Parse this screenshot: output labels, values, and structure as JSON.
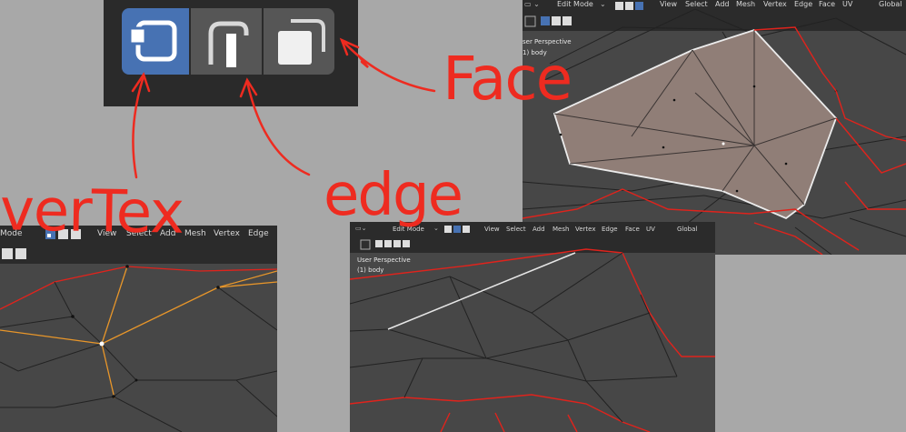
{
  "toolbar_zoom": {
    "buttons": [
      {
        "name": "vertex",
        "selected": true,
        "icon": "vertex-select-icon"
      },
      {
        "name": "edge",
        "selected": false,
        "icon": "edge-select-icon"
      },
      {
        "name": "face",
        "selected": false,
        "icon": "face-select-icon"
      }
    ],
    "colors": {
      "panel": "#2a2a2a",
      "button": "#565656",
      "selected": "#4772b3"
    }
  },
  "annotations": {
    "vertex": "verTex",
    "edge": "edge",
    "face": "Face",
    "color": "#ee2b20"
  },
  "face_panel": {
    "header": {
      "mode": "Edit Mode",
      "menu": [
        "View",
        "Select",
        "Add",
        "Mesh",
        "Vertex",
        "Edge",
        "Face",
        "UV"
      ],
      "transform": "Global"
    },
    "overlay": {
      "perspective": "ser Perspective",
      "object": "1) body"
    }
  },
  "vertex_panel": {
    "header": {
      "mode": "Mode",
      "menu": [
        "View",
        "Select",
        "Add",
        "Mesh",
        "Vertex",
        "Edge"
      ]
    }
  },
  "edge_panel": {
    "header": {
      "mode": "Edit Mode",
      "menu": [
        "View",
        "Select",
        "Add",
        "Mesh",
        "Vertex",
        "Edge",
        "Face",
        "UV"
      ],
      "transform": "Global"
    },
    "overlay": {
      "perspective": "User Perspective",
      "object": "(1) body"
    }
  }
}
